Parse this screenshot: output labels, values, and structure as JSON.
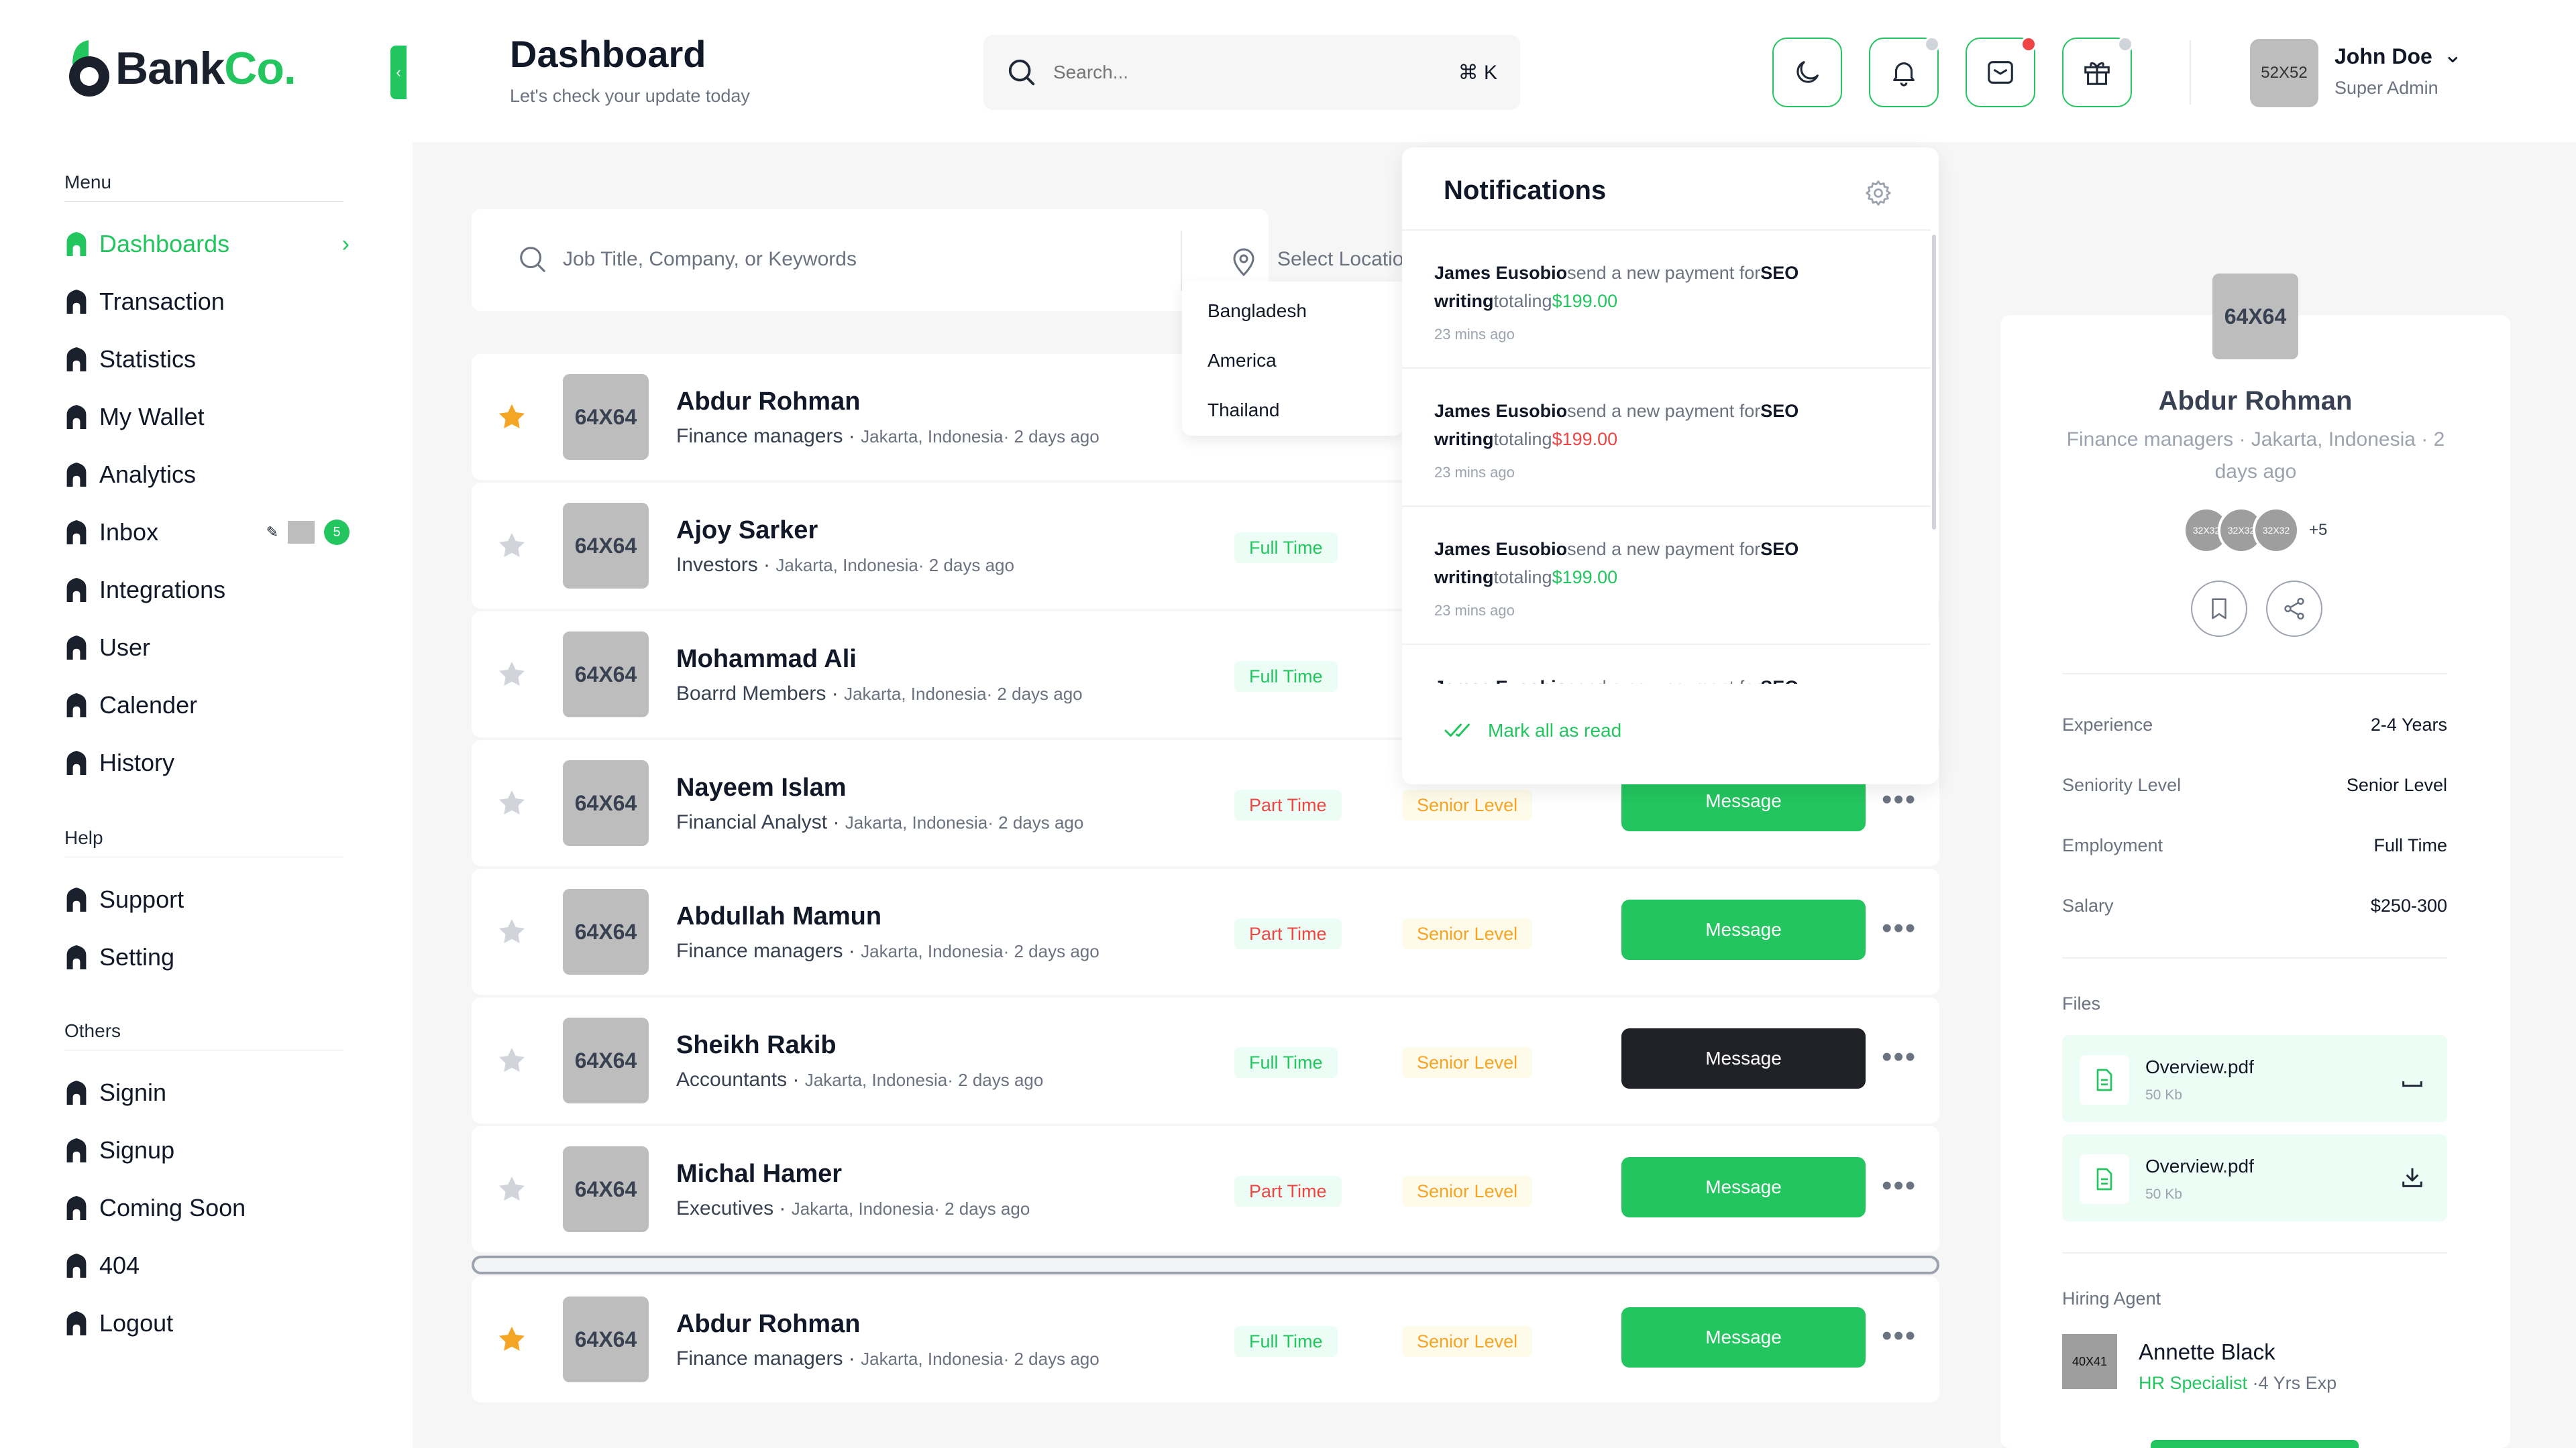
{
  "brand": {
    "name_main": "Bank",
    "name_accent": "Co.",
    "accent": "#22c55e"
  },
  "header": {
    "title": "Dashboard",
    "subtitle": "Let's check your update today",
    "search_placeholder": "Search...",
    "shortcut": "⌘ K",
    "user": {
      "avatar": "52X52",
      "name": "John Doe",
      "role": "Super Admin"
    }
  },
  "sidebar": {
    "menu_title": "Menu",
    "items": [
      {
        "label": "Dashboards",
        "active": true
      },
      {
        "label": "Transaction"
      },
      {
        "label": "Statistics"
      },
      {
        "label": "My Wallet"
      },
      {
        "label": "Analytics"
      },
      {
        "label": "Inbox",
        "badge": "5"
      },
      {
        "label": "Integrations"
      },
      {
        "label": "User"
      },
      {
        "label": "Calender"
      },
      {
        "label": "History"
      }
    ],
    "help_title": "Help",
    "help_items": [
      {
        "label": "Support"
      },
      {
        "label": "Setting"
      }
    ],
    "others_title": "Others",
    "others_items": [
      {
        "label": "Signin"
      },
      {
        "label": "Signup"
      },
      {
        "label": "Coming Soon"
      },
      {
        "label": "404"
      },
      {
        "label": "Logout"
      }
    ]
  },
  "filter": {
    "keyword_placeholder": "Job Title, Company, or Keywords",
    "location_placeholder": "Select Location",
    "location_options": [
      "Bangladesh",
      "America",
      "Thailand"
    ]
  },
  "jobs": [
    {
      "thumb": "64X64",
      "name": "Abdur Rohman",
      "role": "Finance managers",
      "loc": "Jakarta, Indonesia· 2 days ago",
      "type": "",
      "level": "",
      "message": "",
      "starred": true
    },
    {
      "thumb": "64X64",
      "name": "Ajoy Sarker",
      "role": "Investors",
      "loc": "Jakarta, Indonesia· 2 days ago",
      "type": "Full Time",
      "level": "",
      "message": "",
      "starred": false
    },
    {
      "thumb": "64X64",
      "name": "Mohammad Ali",
      "role": "Boarrd Members",
      "loc": "Jakarta, Indonesia· 2 days ago",
      "type": "Full Time",
      "level": "",
      "message": "",
      "starred": false
    },
    {
      "thumb": "64X64",
      "name": "Nayeem Islam",
      "role": "Financial Analyst",
      "loc": "Jakarta, Indonesia· 2 days ago",
      "type": "Part Time",
      "level": "Senior Level",
      "message": "Message",
      "starred": false
    },
    {
      "thumb": "64X64",
      "name": "Abdullah Mamun",
      "role": "Finance managers",
      "loc": "Jakarta, Indonesia· 2 days ago",
      "type": "Part Time",
      "level": "Senior Level",
      "message": "Message",
      "starred": false
    },
    {
      "thumb": "64X64",
      "name": "Sheikh Rakib",
      "role": "Accountants",
      "loc": "Jakarta, Indonesia· 2 days ago",
      "type": "Full Time",
      "level": "Senior Level",
      "message": "Message",
      "starred": false
    },
    {
      "thumb": "64X64",
      "name": "Michal Hamer",
      "role": "Executives",
      "loc": "Jakarta, Indonesia· 2 days ago",
      "type": "Part Time",
      "level": "Senior Level",
      "message": "Message",
      "starred": false
    },
    {
      "thumb": "64X64",
      "name": "Abdur Rohman",
      "role": "Finance managers",
      "loc": "Jakarta, Indonesia· 2 days ago",
      "type": "Full Time",
      "level": "Senior Level",
      "message": "Message",
      "starred": true
    }
  ],
  "notifications": {
    "title": "Notifications",
    "items": [
      {
        "who": "James Eusobio",
        "mid": "send a new payment for",
        "what": "SEO",
        "what2": "writing",
        "totaling": "totaling",
        "amount": "$199.00",
        "amount_color": "green",
        "time": "23 mins ago"
      },
      {
        "who": "James Eusobio",
        "mid": "send a new payment for",
        "what": "SEO",
        "what2": "writing",
        "totaling": "totaling",
        "amount": "$199.00",
        "amount_color": "red",
        "time": "23 mins ago"
      },
      {
        "who": "James Eusobio",
        "mid": "send a new payment for",
        "what": "SEO",
        "what2": "writing",
        "totaling": "totaling",
        "amount": "$199.00",
        "amount_color": "green",
        "time": "23 mins ago"
      },
      {
        "who": "James Eusobio",
        "mid": "send a new payment for",
        "what": "SEO",
        "what2": "",
        "totaling": "",
        "amount": "",
        "amount_color": "green",
        "time": ""
      }
    ],
    "mark_all": "Mark all as read"
  },
  "profile": {
    "avatar": "64X64",
    "name": "Abdur Rohman",
    "meta": "Finance managers · Jakarta, Indonesia · 2 days ago",
    "stack": [
      "32X32",
      "32X32",
      "32X32"
    ],
    "stack_more": "+5",
    "details": [
      {
        "k": "Experience",
        "v": "2-4 Years"
      },
      {
        "k": "Seniority Level",
        "v": "Senior Level"
      },
      {
        "k": "Employment",
        "v": "Full Time"
      },
      {
        "k": "Salary",
        "v": "$250-300"
      }
    ],
    "files_title": "Files",
    "files": [
      {
        "name": "Overview.pdf",
        "size": "50 Kb"
      },
      {
        "name": "Overview.pdf",
        "size": "50 Kb"
      }
    ],
    "hiring_title": "Hiring Agent",
    "agent": {
      "avatar": "40X41",
      "name": "Annette Black",
      "role": "HR Specialist",
      "exp": " ·4 Yrs Exp"
    }
  }
}
